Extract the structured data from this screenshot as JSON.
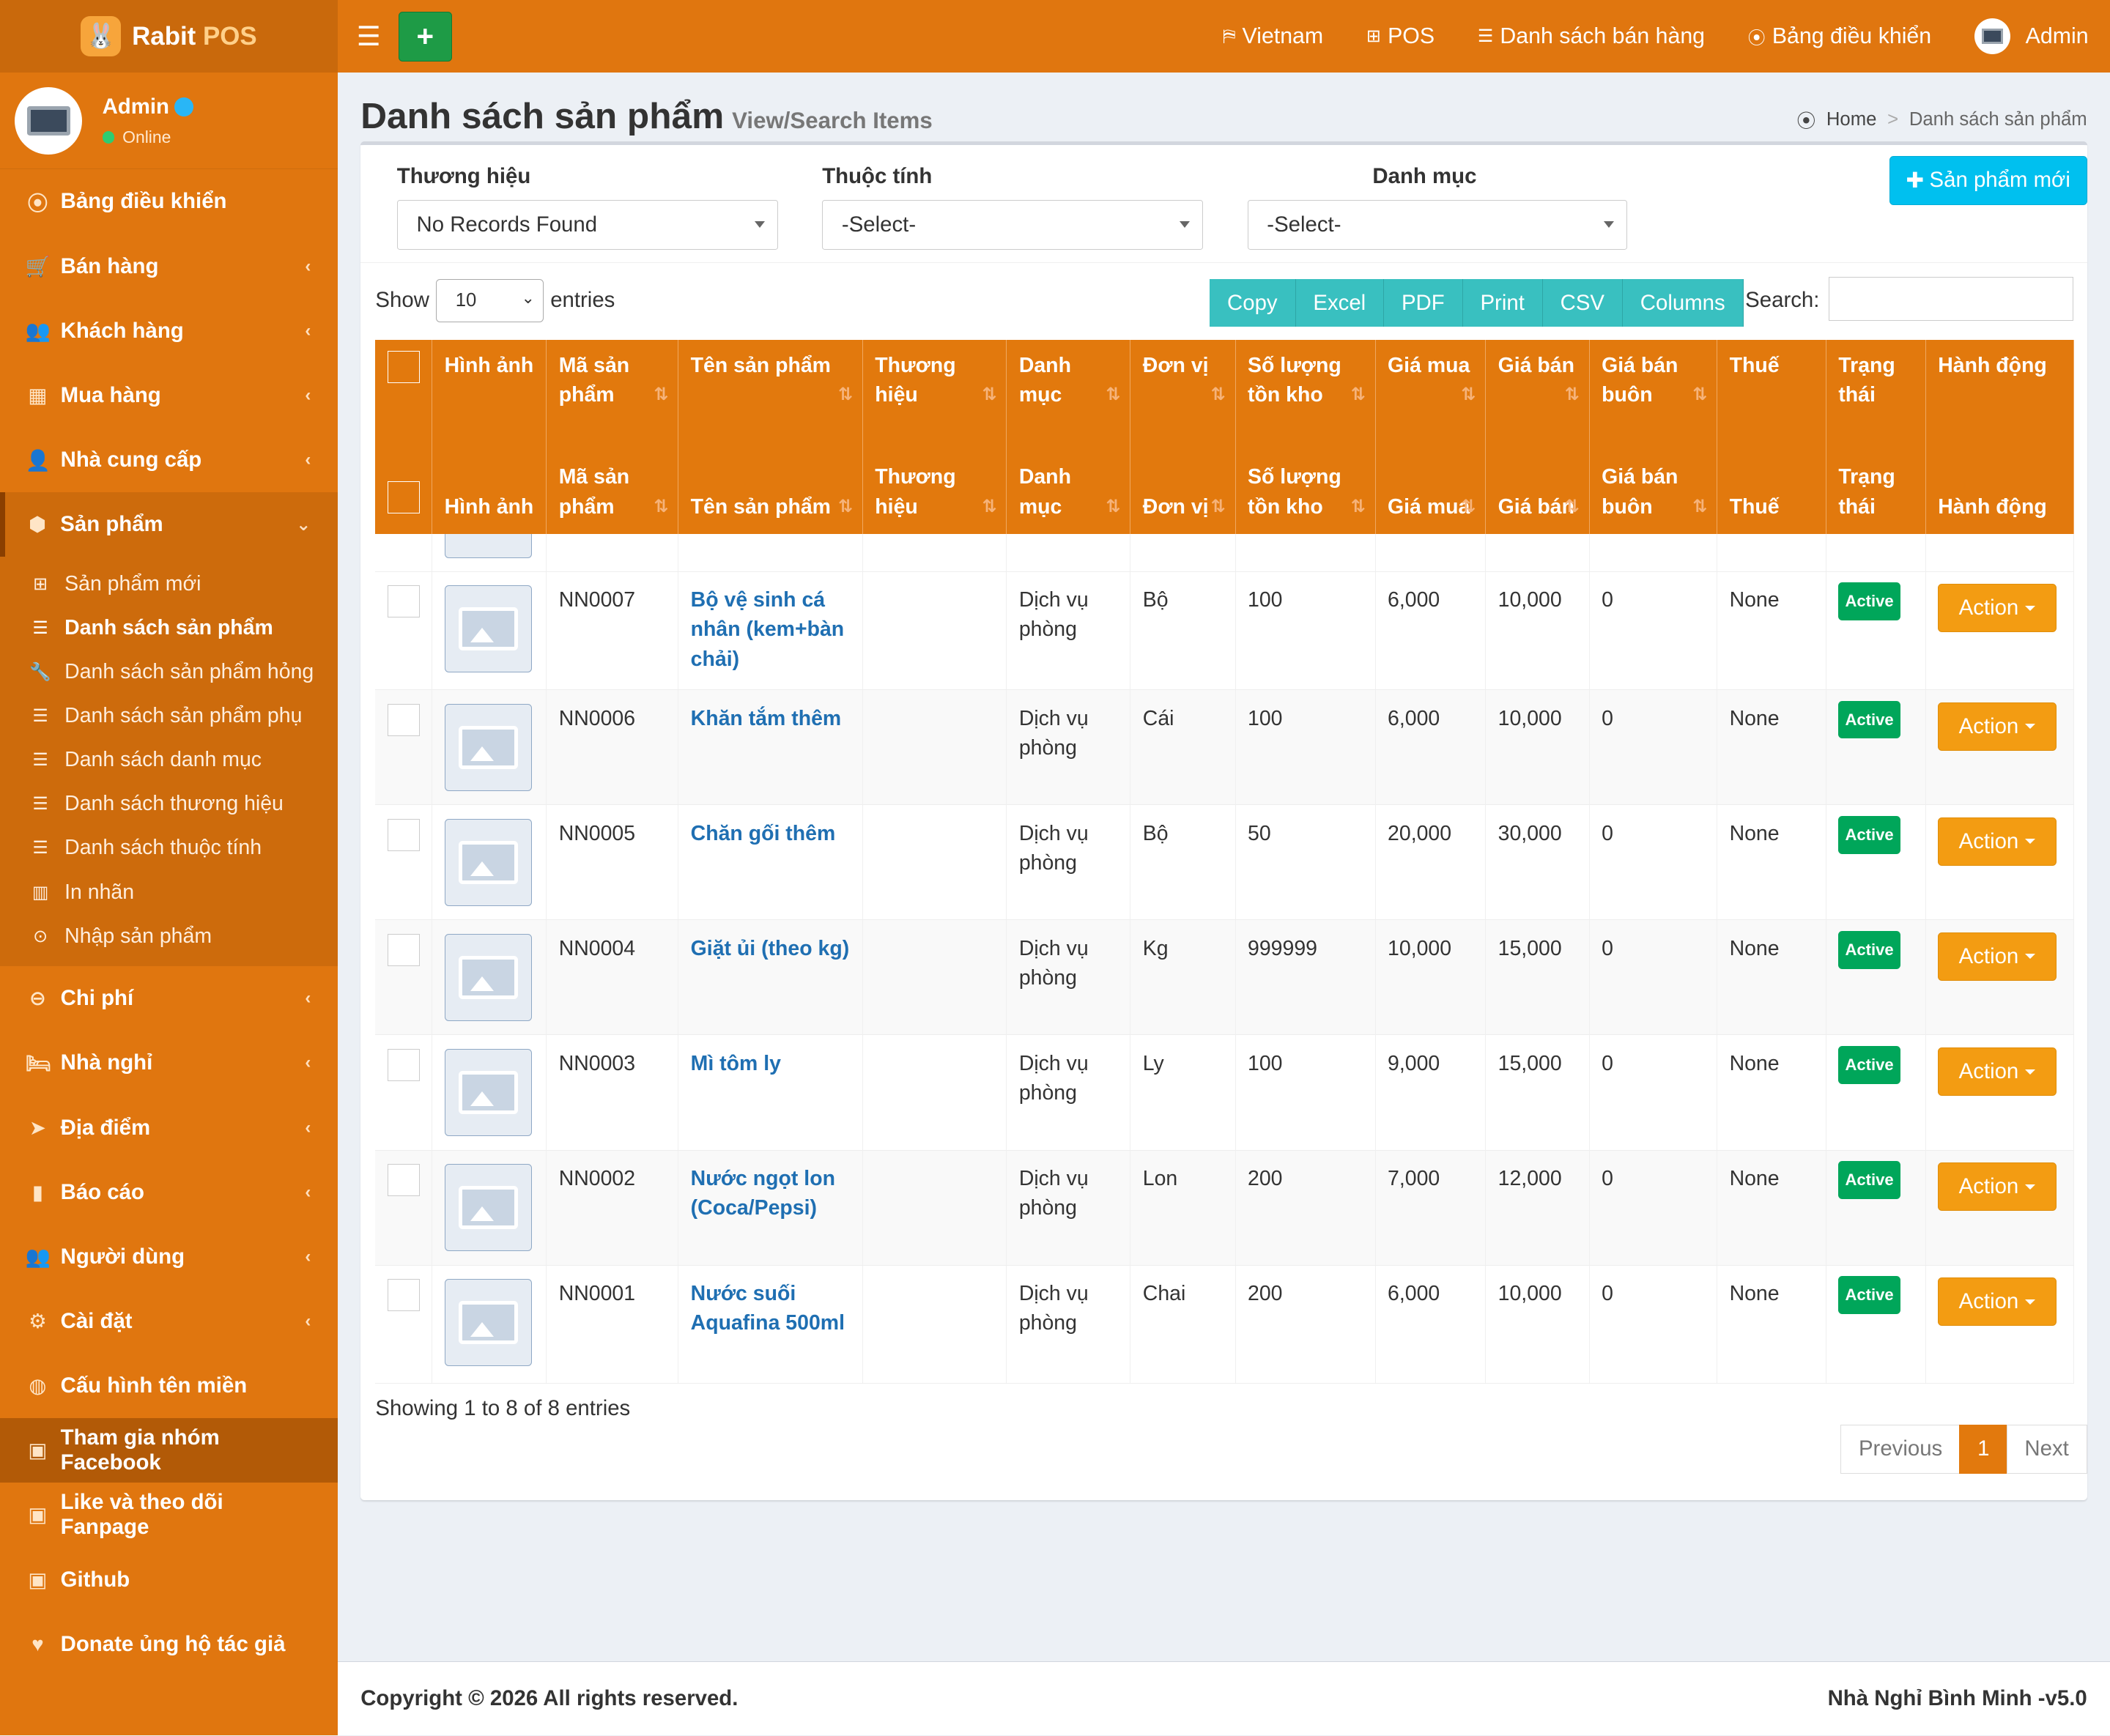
{
  "brand": {
    "name": "Rabit",
    "suffix": "POS"
  },
  "user": {
    "name": "Admin",
    "status": "Online"
  },
  "sidebar": {
    "items": [
      {
        "label": "Bảng điều khiển",
        "icon": "dashboard-icon",
        "glyph": "⦿",
        "chevron": ""
      },
      {
        "label": "Bán hàng",
        "icon": "cart-icon",
        "glyph": "🛒",
        "chevron": "‹"
      },
      {
        "label": "Khách hàng",
        "icon": "users-icon",
        "glyph": "👥",
        "chevron": "‹"
      },
      {
        "label": "Mua hàng",
        "icon": "grid-icon",
        "glyph": "▦",
        "chevron": "‹"
      },
      {
        "label": "Nhà cung cấp",
        "icon": "user-plus-icon",
        "glyph": "👤",
        "chevron": "‹"
      },
      {
        "label": "Sản phẩm",
        "icon": "cubes-icon",
        "glyph": "⬢",
        "chevron": "⌄"
      }
    ],
    "subitems": [
      {
        "label": "Sản phẩm mới",
        "icon": "plus-square-icon",
        "glyph": "⊞"
      },
      {
        "label": "Danh sách sản phẩm",
        "icon": "list-icon",
        "glyph": "☰"
      },
      {
        "label": "Danh sách sản phẩm hỏng",
        "icon": "wrench-icon",
        "glyph": "🔧"
      },
      {
        "label": "Danh sách sản phẩm phụ",
        "icon": "list-icon",
        "glyph": "☰"
      },
      {
        "label": "Danh sách danh mục",
        "icon": "list-icon",
        "glyph": "☰"
      },
      {
        "label": "Danh sách thương hiệu",
        "icon": "list-icon",
        "glyph": "☰"
      },
      {
        "label": "Danh sách thuộc tính",
        "icon": "list-icon",
        "glyph": "☰"
      },
      {
        "label": "In nhãn",
        "icon": "barcode-icon",
        "glyph": "▥"
      },
      {
        "label": "Nhập sản phẩm",
        "icon": "import-icon",
        "glyph": "⊙"
      }
    ],
    "items2": [
      {
        "label": "Chi phí",
        "icon": "minus-circle-icon",
        "glyph": "⊖",
        "chevron": "‹"
      },
      {
        "label": "Nhà nghỉ",
        "icon": "bed-icon",
        "glyph": "🛏",
        "chevron": "‹"
      },
      {
        "label": "Địa điểm",
        "icon": "location-arrow-icon",
        "glyph": "➤",
        "chevron": "‹"
      },
      {
        "label": "Báo cáo",
        "icon": "bar-chart-icon",
        "glyph": "▮",
        "chevron": "‹"
      },
      {
        "label": "Người dùng",
        "icon": "users-icon",
        "glyph": "👥",
        "chevron": "‹"
      },
      {
        "label": "Cài đặt",
        "icon": "cogs-icon",
        "glyph": "⚙",
        "chevron": "‹"
      },
      {
        "label": "Cấu hình tên miền",
        "icon": "globe-icon",
        "glyph": "◍",
        "chevron": ""
      },
      {
        "label": "Tham gia nhóm Facebook",
        "icon": "briefcase-icon",
        "glyph": "▣",
        "chevron": ""
      },
      {
        "label": "Like và theo dõi Fanpage",
        "icon": "briefcase-icon",
        "glyph": "▣",
        "chevron": ""
      },
      {
        "label": "Github",
        "icon": "briefcase-icon",
        "glyph": "▣",
        "chevron": ""
      },
      {
        "label": "Donate ủng hộ tác giả",
        "icon": "heart-icon",
        "glyph": "♥",
        "chevron": ""
      }
    ]
  },
  "topbar": {
    "language": "Vietnam",
    "pos": "POS",
    "sales_list": "Danh sách bán hàng",
    "dashboard": "Bảng điều khiển",
    "user": "Admin"
  },
  "page": {
    "title": "Danh sách sản phẩm",
    "subtitle": "View/Search Items",
    "breadcrumb_home": "Home",
    "breadcrumb_sep": ">",
    "breadcrumb_current": "Danh sách sản phẩm"
  },
  "filters": {
    "brand_label": "Thương hiệu",
    "brand_value": "No Records Found",
    "attribute_label": "Thuộc tính",
    "attribute_value": "-Select-",
    "category_label": "Danh mục",
    "category_value": "-Select-",
    "new_button": "Sản phẩm mới"
  },
  "table_controls": {
    "show": "Show",
    "length": "10",
    "entries": "entries",
    "buttons": [
      "Copy",
      "Excel",
      "PDF",
      "Print",
      "CSV",
      "Columns"
    ],
    "search_label": "Search:"
  },
  "table": {
    "headers": [
      "",
      "Hình ảnh",
      "Mã sản phẩm",
      "Tên sản phẩm",
      "Thương hiệu",
      "Danh mục",
      "Đơn vị",
      "Số lượng tồn kho",
      "Giá mua",
      "Giá bán",
      "Giá bán buôn",
      "Thuế",
      "Trạng thái",
      "Hành động"
    ],
    "rows": [
      {
        "code": "NN0007",
        "name": "Bộ vệ sinh cá nhân (kem+bàn chải)",
        "brand": "",
        "category": "Dịch vụ phòng",
        "unit": "Bộ",
        "qty": "100",
        "buy": "6,000",
        "sell": "10,000",
        "wholesale": "0",
        "tax": "None",
        "status": "Active",
        "action": "Action"
      },
      {
        "code": "NN0006",
        "name": "Khăn tắm thêm",
        "brand": "",
        "category": "Dịch vụ phòng",
        "unit": "Cái",
        "qty": "100",
        "buy": "6,000",
        "sell": "10,000",
        "wholesale": "0",
        "tax": "None",
        "status": "Active",
        "action": "Action"
      },
      {
        "code": "NN0005",
        "name": "Chăn gối thêm",
        "brand": "",
        "category": "Dịch vụ phòng",
        "unit": "Bộ",
        "qty": "50",
        "buy": "20,000",
        "sell": "30,000",
        "wholesale": "0",
        "tax": "None",
        "status": "Active",
        "action": "Action"
      },
      {
        "code": "NN0004",
        "name": "Giặt ủi (theo kg)",
        "brand": "",
        "category": "Dịch vụ phòng",
        "unit": "Kg",
        "qty": "999999",
        "buy": "10,000",
        "sell": "15,000",
        "wholesale": "0",
        "tax": "None",
        "status": "Active",
        "action": "Action"
      },
      {
        "code": "NN0003",
        "name": "Mì tôm ly",
        "brand": "",
        "category": "Dịch vụ phòng",
        "unit": "Ly",
        "qty": "100",
        "buy": "9,000",
        "sell": "15,000",
        "wholesale": "0",
        "tax": "None",
        "status": "Active",
        "action": "Action"
      },
      {
        "code": "NN0002",
        "name": "Nước ngọt lon (Coca/Pepsi)",
        "brand": "",
        "category": "Dịch vụ phòng",
        "unit": "Lon",
        "qty": "200",
        "buy": "7,000",
        "sell": "12,000",
        "wholesale": "0",
        "tax": "None",
        "status": "Active",
        "action": "Action"
      },
      {
        "code": "NN0001",
        "name": "Nước suối Aquafina 500ml",
        "brand": "",
        "category": "Dịch vụ phòng",
        "unit": "Chai",
        "qty": "200",
        "buy": "6,000",
        "sell": "10,000",
        "wholesale": "0",
        "tax": "None",
        "status": "Active",
        "action": "Action"
      }
    ],
    "info": "Showing 1 to 8 of 8 entries"
  },
  "pagination": {
    "previous": "Previous",
    "page": "1",
    "next": "Next"
  },
  "footer": {
    "copyright": "Copyright © 2026 All rights reserved.",
    "version": "Nhà Nghỉ Bình Minh -v5.0"
  },
  "colors": {
    "primary": "#e0760f",
    "accent_button": "#00c0ef",
    "export_buttons": "#39c0c0",
    "status_active": "#00a65a",
    "action_button": "#f39c12",
    "add_button": "#1e9b46",
    "link": "#1f6fb2"
  }
}
